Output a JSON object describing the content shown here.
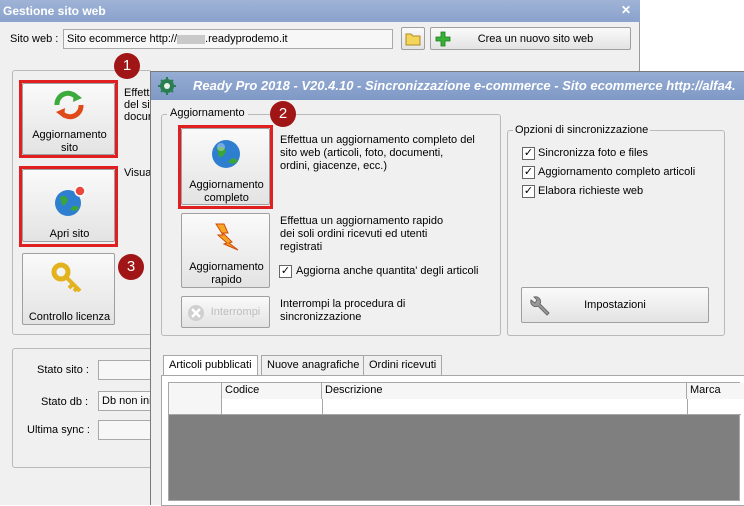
{
  "back_window": {
    "title": "Gestione sito web",
    "close_glyph": "✕",
    "site_label": "Sito web :",
    "site_value": "Sito ecommerce http://",
    "site_domain": ".readyprodemo.it",
    "new_site_button": "Crea un nuovo sito web",
    "buttons": {
      "update_line1": "Aggiornamento",
      "update_line2": "sito",
      "open_site": "Apri sito",
      "license": "Controllo licenza"
    },
    "side_text": {
      "update_l1": "Effettu",
      "update_l2": "del sit",
      "update_l3": "docum",
      "open": "Visual"
    },
    "status": {
      "site_label": "Stato sito :",
      "db_label": "Stato db :",
      "db_value": "Db non iniz",
      "sync_label": "Ultima sync :"
    }
  },
  "badges": {
    "one": "1",
    "two": "2",
    "three": "3"
  },
  "front_window": {
    "title": "Ready Pro 2018 - V20.4.10 - Sincronizzazione e-commerce - Sito ecommerce http://alfa4.",
    "group_update": "Aggiornamento",
    "full_update_line1": "Aggiornamento",
    "full_update_line2": "completo",
    "full_update_desc": "Effettua un aggiornamento completo del sito web (articoli, foto, documenti, ordini, giacenze, ecc.)",
    "quick_update_line1": "Aggiornamento",
    "quick_update_line2": "rapido",
    "quick_update_desc": "Effettua un aggiornamento rapido dei soli ordini ricevuti ed utenti registrati",
    "quick_update_check": "Aggiorna anche quantita' degli articoli",
    "stop_button": "Interrompi",
    "stop_desc": "Interrompi la procedura di sincronizzazione",
    "sync_options_title": "Opzioni di sincronizzazione",
    "sync_options": [
      "Sincronizza foto e files",
      "Aggiornamento completo articoli",
      "Elabora richieste web"
    ],
    "settings_button": "Impostazioni",
    "tabs": [
      "Articoli pubblicati",
      "Nuove anagrafiche",
      "Ordini ricevuti"
    ],
    "columns": [
      "Codice",
      "Descrizione",
      "Marca"
    ],
    "check_glyph": "✓"
  },
  "colors": {
    "highlight": "#e02020",
    "badge": "#a01515"
  }
}
